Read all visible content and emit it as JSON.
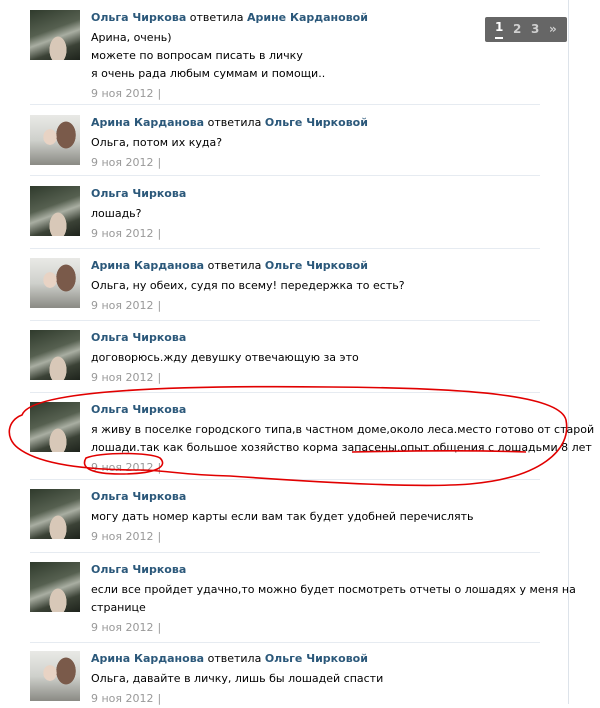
{
  "pager": {
    "pages": [
      "1",
      "2",
      "3"
    ],
    "next": "»"
  },
  "posts": [
    {
      "author": "Ольга Чиркова",
      "verb": "ответила",
      "target": "Арине Кардановой",
      "lines": [
        "Арина, очень)",
        "можете по вопросам писать в личку",
        "я очень рада любым суммам и помощи.."
      ],
      "date": "9 ноя 2012",
      "sep": "|",
      "avatar": "olga"
    },
    {
      "author": "Арина Карданова",
      "verb": "ответила",
      "target": "Ольге Чирковой",
      "lines": [
        "Ольга, потом их куда?"
      ],
      "date": "9 ноя 2012",
      "sep": "|",
      "avatar": "arina"
    },
    {
      "author": "Ольга Чиркова",
      "verb": "",
      "target": "",
      "lines": [
        "лошадь?"
      ],
      "date": "9 ноя 2012",
      "sep": "|",
      "avatar": "olga"
    },
    {
      "author": "Арина Карданова",
      "verb": "ответила",
      "target": "Ольге Чирковой",
      "lines": [
        "Ольга, ну обеих, судя по всему! передержка то есть?"
      ],
      "date": "9 ноя 2012",
      "sep": "|",
      "avatar": "arina"
    },
    {
      "author": "Ольга Чиркова",
      "verb": "",
      "target": "",
      "lines": [
        "договорюсь.жду девушку отвечающую за это"
      ],
      "date": "9 ноя 2012",
      "sep": "|",
      "avatar": "olga"
    },
    {
      "author": "Ольга Чиркова",
      "verb": "",
      "target": "",
      "lines": [
        "я живу в поселке городского типа,в частном доме,около леса.место готово от старой",
        "лошади.так как большое хозяйство корма запасены.опыт общения с лошадьми 8 лет"
      ],
      "date": "9 ноя 2012",
      "sep": "|",
      "avatar": "olga"
    },
    {
      "author": "Ольга Чиркова",
      "verb": "",
      "target": "",
      "lines": [
        "могу дать номер карты если вам так будет удобней перечислять"
      ],
      "date": "9 ноя 2012",
      "sep": "|",
      "avatar": "olga"
    },
    {
      "author": "Ольга Чиркова",
      "verb": "",
      "target": "",
      "lines": [
        "если все пройдет удачно,то можно будет посмотреть отчеты о лошадях у меня на",
        "странице"
      ],
      "date": "9 ноя 2012",
      "sep": "|",
      "avatar": "olga"
    },
    {
      "author": "Арина Карданова",
      "verb": "ответила",
      "target": "Ольге Чирковой",
      "lines": [
        "Ольга, давайте в личку, лишь бы лошадей спасти"
      ],
      "date": "9 ноя 2012",
      "sep": "|",
      "avatar": "arina"
    }
  ]
}
